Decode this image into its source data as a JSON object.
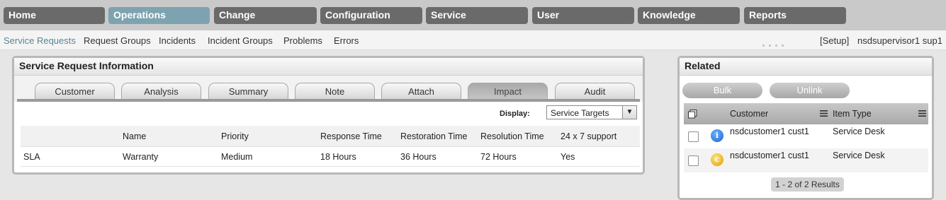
{
  "topnav": {
    "tabs": [
      {
        "label": "Home",
        "active": false
      },
      {
        "label": "Operations",
        "active": true
      },
      {
        "label": "Change",
        "active": false
      },
      {
        "label": "Configuration",
        "active": false
      },
      {
        "label": "Service",
        "active": false
      },
      {
        "label": "User",
        "active": false
      },
      {
        "label": "Knowledge",
        "active": false
      },
      {
        "label": "Reports",
        "active": false
      }
    ]
  },
  "subnav": {
    "items": [
      "Service Requests",
      "Request Groups",
      "Incidents",
      "Incident Groups",
      "Problems",
      "Errors"
    ],
    "setup": "[Setup]",
    "user": "nsdsupervisor1 sup1"
  },
  "sri": {
    "title": "Service Request Information",
    "tabs": [
      "Customer",
      "Analysis",
      "Summary",
      "Note",
      "Attach",
      "Impact",
      "Audit"
    ],
    "active_tab": "Impact",
    "display_label": "Display:",
    "display_value": "Service Targets",
    "columns": [
      "",
      "Name",
      "Priority",
      "Response Time",
      "Restoration Time",
      "Resolution Time",
      "24 x 7 support"
    ],
    "rows": [
      [
        "SLA",
        "Warranty",
        "Medium",
        "18 Hours",
        "36 Hours",
        "72 Hours",
        "Yes"
      ]
    ]
  },
  "related": {
    "title": "Related",
    "bulk_label": "Bulk",
    "unlink_label": "Unlink",
    "col_customer": "Customer",
    "col_item_type": "Item Type",
    "rows": [
      {
        "icon": "info-icon",
        "icon_glyph": "i",
        "customer": "nsdcustomer1 cust1",
        "item_type": "Service Desk"
      },
      {
        "icon": "customer-icon",
        "icon_glyph": "c",
        "customer": "nsdcustomer1 cust1",
        "item_type": "Service Desk"
      }
    ],
    "results": "1 - 2 of 2 Results"
  },
  "colors": {
    "nav_tab": "#6a6a6a",
    "nav_tab_active": "#7ea3b0",
    "subnav_active": "#5a8595"
  }
}
